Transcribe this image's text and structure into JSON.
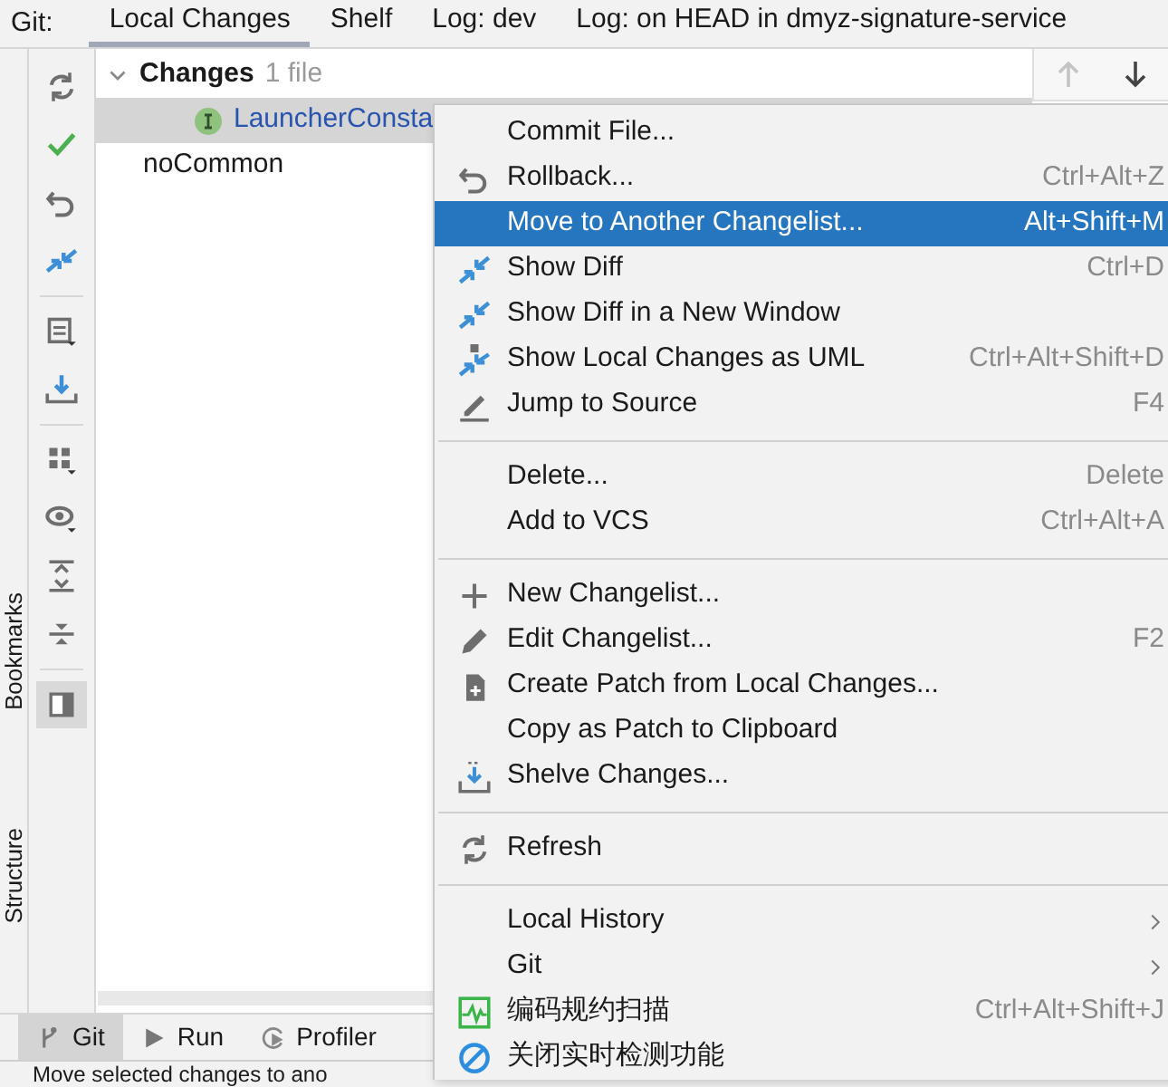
{
  "tool_window": {
    "title": "Git:",
    "tabs": [
      {
        "label": "Local Changes",
        "selected": true
      },
      {
        "label": "Shelf",
        "selected": false
      },
      {
        "label": "Log: dev",
        "selected": false
      },
      {
        "label": "Log: on HEAD in dmyz-signature-service",
        "selected": false
      }
    ]
  },
  "side_stripe": [
    "Bookmarks",
    "Structure"
  ],
  "tree": [
    {
      "label": "Changes",
      "count": "1 file",
      "expanded": true,
      "children": [
        {
          "label": "LauncherConsta",
          "selected": true
        }
      ]
    },
    {
      "label": "noCommon"
    }
  ],
  "navigation": [
    {
      "disabled": true
    },
    {
      "disabled": false
    }
  ],
  "context_menu": [
    {
      "kind": "item",
      "label": "Commit File...",
      "selected": false
    },
    {
      "kind": "item",
      "label": "Rollback...",
      "shortcut": "Ctrl+Alt+Z",
      "selected": false
    },
    {
      "kind": "item",
      "label": "Move to Another Changelist...",
      "shortcut": "Alt+Shift+M",
      "selected": true
    },
    {
      "kind": "item",
      "label": "Show Diff",
      "shortcut": "Ctrl+D",
      "selected": false
    },
    {
      "kind": "item",
      "label": "Show Diff in a New Window",
      "selected": false
    },
    {
      "kind": "item",
      "label": "Show Local Changes as UML",
      "shortcut": "Ctrl+Alt+Shift+D",
      "selected": false
    },
    {
      "kind": "item",
      "label": "Jump to Source",
      "shortcut": "F4",
      "selected": false
    },
    {
      "kind": "separator"
    },
    {
      "kind": "item",
      "label": "Delete...",
      "shortcut": "Delete",
      "selected": false
    },
    {
      "kind": "item",
      "label": "Add to VCS",
      "shortcut": "Ctrl+Alt+A",
      "selected": false
    },
    {
      "kind": "separator"
    },
    {
      "kind": "item",
      "label": "New Changelist...",
      "selected": false
    },
    {
      "kind": "item",
      "label": "Edit Changelist...",
      "shortcut": "F2",
      "selected": false
    },
    {
      "kind": "item",
      "label": "Create Patch from Local Changes...",
      "selected": false
    },
    {
      "kind": "item",
      "label": "Copy as Patch to Clipboard",
      "selected": false
    },
    {
      "kind": "item",
      "label": "Shelve Changes...",
      "selected": false
    },
    {
      "kind": "separator"
    },
    {
      "kind": "item",
      "label": "Refresh",
      "selected": false
    },
    {
      "kind": "separator"
    },
    {
      "kind": "submenu",
      "label": "Local History",
      "selected": false
    },
    {
      "kind": "submenu",
      "label": "Git",
      "selected": false
    },
    {
      "kind": "item",
      "label": "编码规约扫描",
      "shortcut": "Ctrl+Alt+Shift+J",
      "selected": false
    },
    {
      "kind": "item",
      "label": "关闭实时检测功能",
      "selected": false
    }
  ],
  "bottom_tabs": [
    {
      "label": "Git",
      "selected": true
    },
    {
      "label": "Run",
      "selected": false
    },
    {
      "label": "Profiler",
      "selected": false
    }
  ],
  "status_bar": "Move selected changes to ano"
}
